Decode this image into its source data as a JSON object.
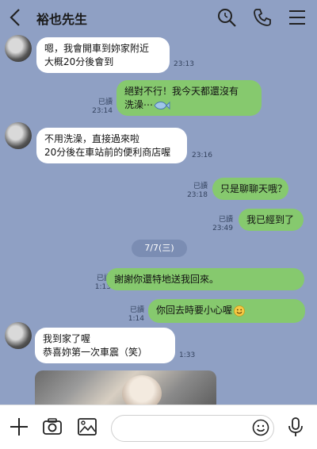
{
  "header": {
    "title": "裕也先生"
  },
  "messages": [
    {
      "dir": "in",
      "lines": [
        "嗯，我會開車到妳家附近",
        "大概20分後會到"
      ],
      "time": "23:13"
    },
    {
      "dir": "out",
      "lines": [
        "絕對不行！我今天都還沒有",
        "洗澡⋯"
      ],
      "read": "已讀",
      "time": "23:14"
    },
    {
      "dir": "in",
      "lines": [
        "不用洗澡，直接過來啦",
        "20分後在車站前的便利商店喔"
      ],
      "time": "23:16"
    },
    {
      "dir": "out",
      "lines": [
        "只是聊聊天哦？"
      ],
      "read": "已讀",
      "time": "23:18"
    },
    {
      "dir": "out",
      "lines": [
        "我已經到了"
      ],
      "read": "已讀",
      "time": "23:49"
    },
    {
      "dir": "out",
      "lines": [
        "謝謝你還特地送我回來。"
      ],
      "read": "已讀",
      "time": "1:13"
    },
    {
      "dir": "out",
      "lines": [
        "你回去時要小心喔"
      ],
      "read": "已讀",
      "time": "1:14"
    },
    {
      "dir": "in",
      "lines": [
        "我到家了喔",
        "恭喜妳第一次車震（笑）"
      ],
      "time": "1:33"
    }
  ],
  "date_divider": "7/7(三)",
  "composer": {
    "placeholder": ""
  },
  "colors": {
    "background": "#8fa0c4",
    "outgoing": "#86c96e",
    "incoming": "#ffffff"
  },
  "icons": [
    "back-icon",
    "search-icon",
    "phone-icon",
    "menu-icon",
    "plus-icon",
    "camera-icon",
    "image-icon",
    "emoji-icon",
    "mic-icon"
  ]
}
